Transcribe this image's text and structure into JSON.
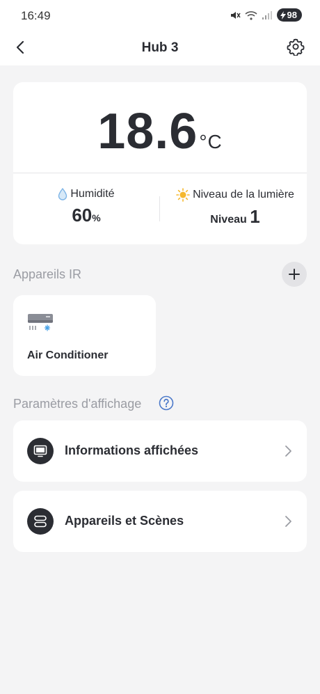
{
  "status_bar": {
    "time": "16:49",
    "battery": "98"
  },
  "header": {
    "title": "Hub 3"
  },
  "temperature": {
    "value": "18.6",
    "unit": "°C"
  },
  "humidity": {
    "label": "Humidité",
    "value": "60",
    "unit": "%"
  },
  "light": {
    "label": "Niveau de la lumière",
    "prefix": "Niveau",
    "value": "1"
  },
  "ir_section": {
    "title": "Appareils IR"
  },
  "ir_devices": [
    {
      "name": "Air Conditioner"
    }
  ],
  "display_section": {
    "title": "Paramètres d'affichage"
  },
  "display_rows": [
    {
      "label": "Informations affichées"
    },
    {
      "label": "Appareils et Scènes"
    }
  ],
  "colors": {
    "accent": "#2b2d33",
    "background": "#f4f4f5",
    "help": "#4a78c9",
    "sun": "#f5b82e",
    "drop": "#7db4e6"
  }
}
